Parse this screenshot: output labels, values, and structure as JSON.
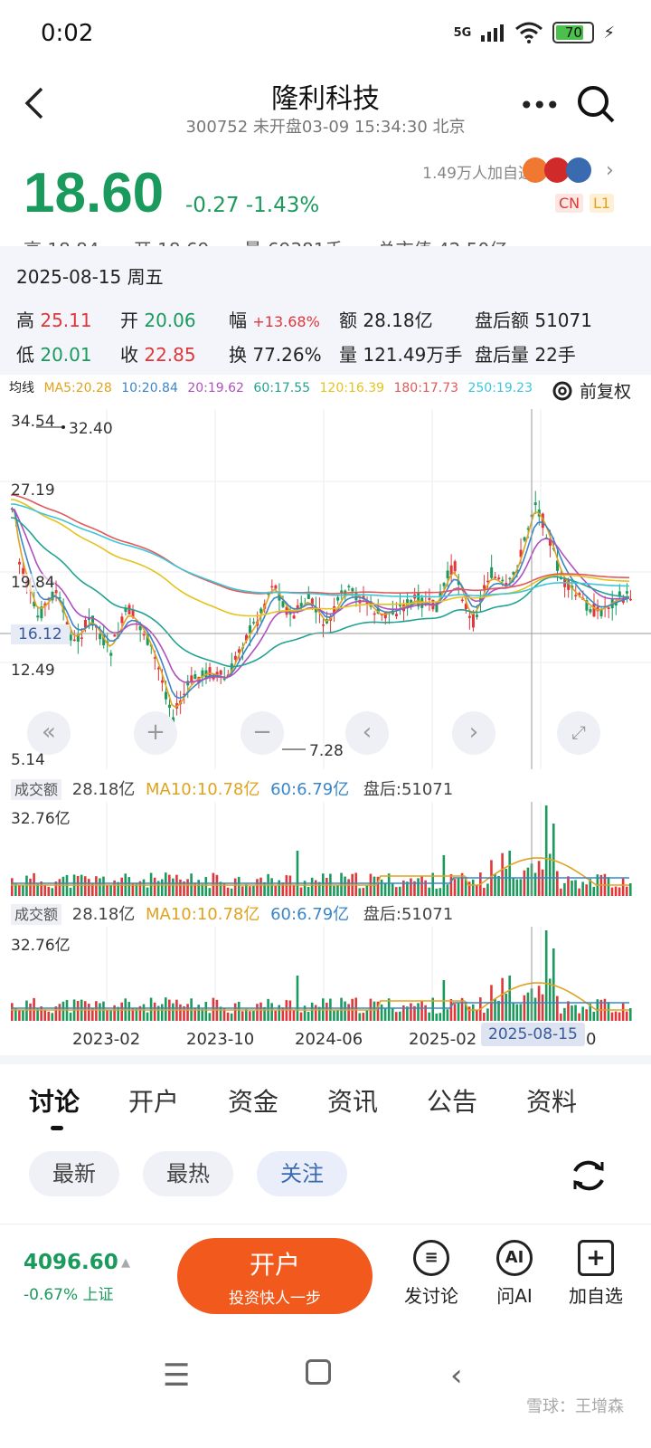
{
  "status": {
    "time": "0:02",
    "network": "5G",
    "battery": "70"
  },
  "header": {
    "title": "隆利科技",
    "subtitle": "300752 未开盘03-09 15:34:30 北京"
  },
  "quote": {
    "price": "18.60",
    "change": "-0.27 -1.43%",
    "followers": "1.49万人加自选",
    "badge_cn": "CN",
    "badge_l1": "L1",
    "cut_row": "高 18.84      开 18.69      量 69381手      总市值 42.50亿"
  },
  "detail": {
    "date": "2025-08-15 周五",
    "row1": [
      {
        "k": "高",
        "v": "25.11"
      },
      {
        "k": "开",
        "v": "20.06"
      },
      {
        "k": "幅",
        "v": "+13.68%"
      },
      {
        "k": "额",
        "v": "28.18亿"
      },
      {
        "k": "盘后额",
        "v": "51071"
      }
    ],
    "row2": [
      {
        "k": "低",
        "v": "20.01"
      },
      {
        "k": "收",
        "v": "22.85"
      },
      {
        "k": "换",
        "v": "77.26%"
      },
      {
        "k": "量",
        "v": "121.49万手"
      },
      {
        "k": "盘后量",
        "v": "22手"
      }
    ]
  },
  "ma_legend": {
    "label": "均线",
    "items": [
      {
        "text": "MA5:20.28",
        "color": "#e0a320"
      },
      {
        "text": "10:20.84",
        "color": "#3a86c8"
      },
      {
        "text": "20:19.62",
        "color": "#b04fc0"
      },
      {
        "text": "60:17.55",
        "color": "#21a394"
      },
      {
        "text": "120:16.39",
        "color": "#e6c21c"
      },
      {
        "text": "180:17.73",
        "color": "#e05a5a"
      },
      {
        "text": "250:19.23",
        "color": "#3ec6d8"
      }
    ],
    "adjust": "前复权"
  },
  "kline": {
    "y_top": "34.54",
    "y2": "27.19",
    "y3": "19.84",
    "y4": "12.49",
    "y_bottom": "5.14",
    "high_mark": "32.40",
    "low_mark": "7.28",
    "crosshair_price": "16.12"
  },
  "volume1": {
    "label": "成交额",
    "value": "28.18亿",
    "ma10": "MA10:10.78亿",
    "ma60": "60:6.79亿",
    "after": "盘后:51071",
    "ymax": "32.76亿"
  },
  "volume2": {
    "label": "成交额",
    "value": "28.18亿",
    "ma10": "MA10:10.78亿",
    "ma60": "60:6.79亿",
    "after": "盘后:51071",
    "ymax": "32.76亿"
  },
  "xaxis": [
    "2023-02",
    "2023-10",
    "2024-06",
    "2025-02"
  ],
  "xaxis_tail": "0",
  "crosshair_date": "2025-08-15",
  "tabs": [
    "讨论",
    "开户",
    "资金",
    "资讯",
    "公告",
    "资料"
  ],
  "filters": [
    "最新",
    "最热",
    "关注"
  ],
  "bottom": {
    "index_value": "4096.60",
    "index_change": "-0.67% 上证",
    "open_main": "开户",
    "open_sub": "投资快人一步",
    "actions": [
      {
        "label": "发讨论",
        "icon": "≡"
      },
      {
        "label": "问AI",
        "icon": "AI"
      },
      {
        "label": "加自选",
        "icon": "+"
      }
    ]
  },
  "watermark": "雪球：王增森",
  "colors": {
    "up": "#e0373a",
    "down": "#1a9a5c",
    "accent": "#f15a1c"
  }
}
